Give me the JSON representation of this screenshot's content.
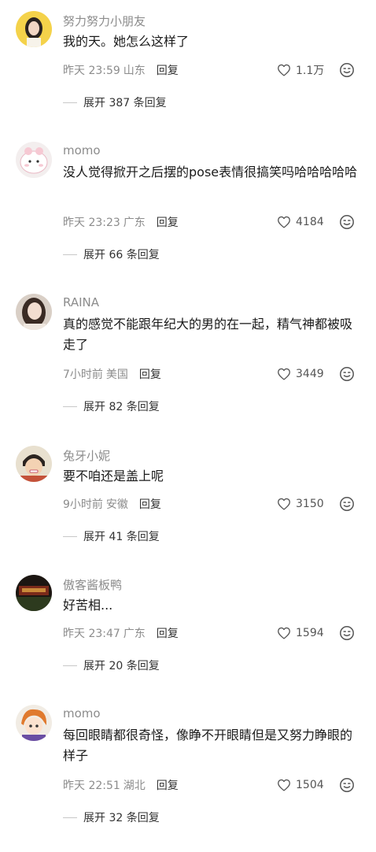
{
  "comments": [
    {
      "username": "努力努力小朋友",
      "content": "我的天。她怎么这样了",
      "time": "昨天 23:59",
      "location": "山东",
      "reply_label": "回复",
      "likes": "1.1万",
      "expand": "展开 387 条回复"
    },
    {
      "username": "momo",
      "content": "没人觉得掀开之后摆的pose表情很搞笑吗哈哈哈哈哈",
      "time": "昨天 23:23",
      "location": "广东",
      "reply_label": "回复",
      "likes": "4184",
      "expand": "展开 66 条回复"
    },
    {
      "username": "RAINA",
      "content": "真的感觉不能跟年纪大的男的在一起，精气神都被吸走了",
      "time": "7小时前",
      "location": "美国",
      "reply_label": "回复",
      "likes": "3449",
      "expand": "展开 82 条回复"
    },
    {
      "username": "兔牙小妮",
      "content": "要不咱还是盖上呢",
      "time": "9小时前",
      "location": "安徽",
      "reply_label": "回复",
      "likes": "3150",
      "expand": "展开 41 条回复"
    },
    {
      "username": "傲客酱板鸭",
      "content": "好苦相...",
      "time": "昨天 23:47",
      "location": "广东",
      "reply_label": "回复",
      "likes": "1594",
      "expand": "展开 20 条回复"
    },
    {
      "username": "momo",
      "content": "每回眼睛都很奇怪，像睁不开眼睛但是又努力睁眼的样子",
      "time": "昨天 22:51",
      "location": "湖北",
      "reply_label": "回复",
      "likes": "1504",
      "expand": "展开 32 条回复"
    }
  ],
  "icons": {
    "like": "heart-outline-icon",
    "emoji": "emoji-face-icon"
  },
  "colors": {
    "text": "#1a1a1a",
    "meta": "#8c8c8c",
    "icon": "#555555"
  }
}
